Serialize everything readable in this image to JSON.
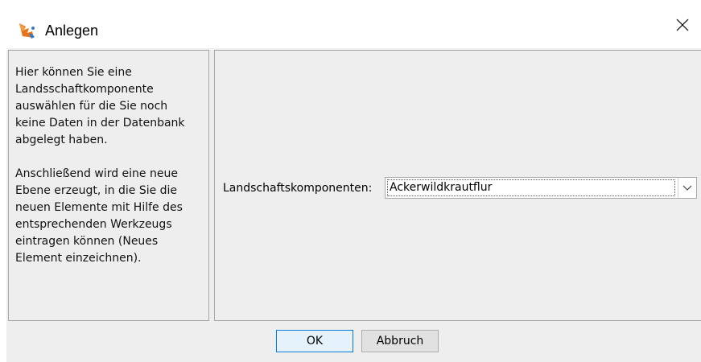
{
  "window": {
    "title": "Anlegen",
    "icon": "app-icon",
    "close_icon": "close-icon"
  },
  "help": {
    "text": "Hier können Sie eine\nLandsschaftkomponente\nauswählen für die Sie noch\nkeine Daten in der Datenbank\nabgelegt haben.\n\nAnschließend wird eine neue\nEbene erzeugt, in die Sie die\nneuen Elemente mit Hilfe des\nentsprechenden Werkzeugs\neintragen können (Neues\nElement einzeichnen)."
  },
  "form": {
    "component_label": "Landschaftskomponenten:",
    "component_value": "Ackerwildkrautflur",
    "dropdown_icon": "chevron-down-icon"
  },
  "buttons": {
    "ok_label": "OK",
    "cancel_label": "Abbruch"
  },
  "colors": {
    "accent": "#0078d7",
    "panel_background": "#eeeeee"
  }
}
